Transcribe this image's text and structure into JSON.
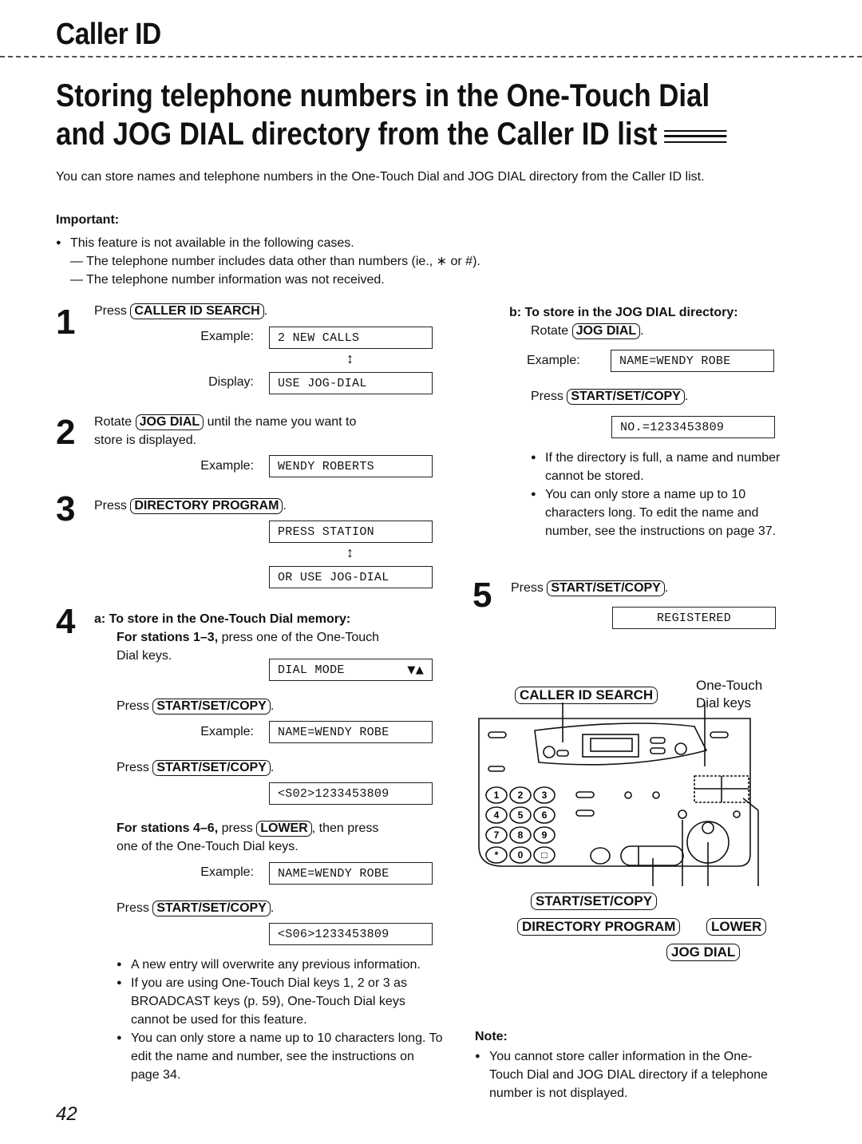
{
  "header": {
    "section_title": "Caller ID",
    "page_title_line1": "Storing telephone numbers in the One-Touch Dial",
    "page_title_line2": "and JOG DIAL directory from the Caller ID list"
  },
  "intro": "You can store names and telephone numbers in the One-Touch Dial and JOG DIAL directory from the Caller ID list.",
  "important": {
    "label": "Important:",
    "bullet": "This feature is not available in the following cases.",
    "cases": [
      "— The telephone number includes data other than numbers (ie., ∗ or #).",
      "— The telephone number information was not received."
    ]
  },
  "steps": {
    "s1": {
      "num": "1",
      "prefix": "Press",
      "key": "CALLER ID SEARCH",
      "suffix": ".",
      "example_label": "Example:",
      "example_lcd": "2 NEW CALLS",
      "display_label": "Display:",
      "display_lcd": "USE JOG-DIAL"
    },
    "s2": {
      "num": "2",
      "prefix": "Rotate",
      "key": "JOG DIAL",
      "text1": "until the name you want to",
      "text2": "store is displayed.",
      "example_label": "Example:",
      "example_lcd": "WENDY ROBERTS"
    },
    "s3": {
      "num": "3",
      "prefix": "Press",
      "key": "DIRECTORY PROGRAM",
      "suffix": ".",
      "lcd1": "PRESS STATION",
      "lcd2": "OR USE JOG-DIAL"
    },
    "s4": {
      "num": "4",
      "a_heading": "a: To store in the One-Touch Dial memory:",
      "stations_1_3_bold": "For stations 1–3,",
      "stations_1_3_text": "press one of the One-Touch",
      "stations_1_3_text2": "Dial keys.",
      "lcd_dial_mode": "DIAL MODE",
      "lcd_dial_mode_arrows": "▼▲",
      "press1_prefix": "Press",
      "press1_key": "START/SET/COPY",
      "example_label": "Example:",
      "lcd_name1": "NAME=WENDY ROBE",
      "press2_prefix": "Press",
      "press2_key": "START/SET/COPY",
      "lcd_s02": "<S02>1233453809",
      "stations_4_6_bold": "For stations 4–6,",
      "stations_4_6_text": "press",
      "lower_key": "LOWER",
      "stations_4_6_text2": ", then press",
      "stations_4_6_text3": "one of the One-Touch Dial keys.",
      "example_label2": "Example:",
      "lcd_name2": "NAME=WENDY ROBE",
      "press3_prefix": "Press",
      "press3_key": "START/SET/COPY",
      "lcd_s06": "<S06>1233453809",
      "notes": [
        "A new entry will overwrite any previous information.",
        "If you are using One-Touch Dial keys 1, 2 or 3 as BROADCAST keys (p. 59), One-Touch Dial keys cannot be used for this feature.",
        "You can only store a name up to 10 characters long. To edit the name and number, see the instructions on page 34."
      ],
      "b_heading": "b: To store in the JOG DIAL directory:",
      "b_rotate_prefix": "Rotate",
      "b_rotate_key": "JOG DIAL",
      "b_example_label": "Example:",
      "b_lcd_name": "NAME=WENDY ROBE",
      "b_press_prefix": "Press",
      "b_press_key": "START/SET/COPY",
      "b_lcd_no": "NO.=1233453809",
      "b_notes": [
        "If the directory is full, a name and number cannot be stored.",
        "You can only store a name up to 10 characters long. To edit the name and number, see the instructions on page 37."
      ]
    },
    "s5": {
      "num": "5",
      "prefix": "Press",
      "key": "START/SET/COPY",
      "suffix": ".",
      "lcd": "REGISTERED"
    }
  },
  "diagram": {
    "caller_id_search": "CALLER ID SEARCH",
    "one_touch_label": "One-Touch",
    "dial_keys_label": "Dial keys",
    "start_set_copy": "START/SET/COPY",
    "directory_program": "DIRECTORY PROGRAM",
    "lower": "LOWER",
    "jog_dial": "JOG DIAL",
    "keypad": [
      "1",
      "2",
      "3",
      "4",
      "5",
      "6",
      "7",
      "8",
      "9",
      "*",
      "0",
      "□"
    ]
  },
  "note": {
    "label": "Note:",
    "text": "You cannot store caller information in the One-Touch Dial and JOG DIAL directory if a telephone number is not displayed."
  },
  "page_number": "42"
}
